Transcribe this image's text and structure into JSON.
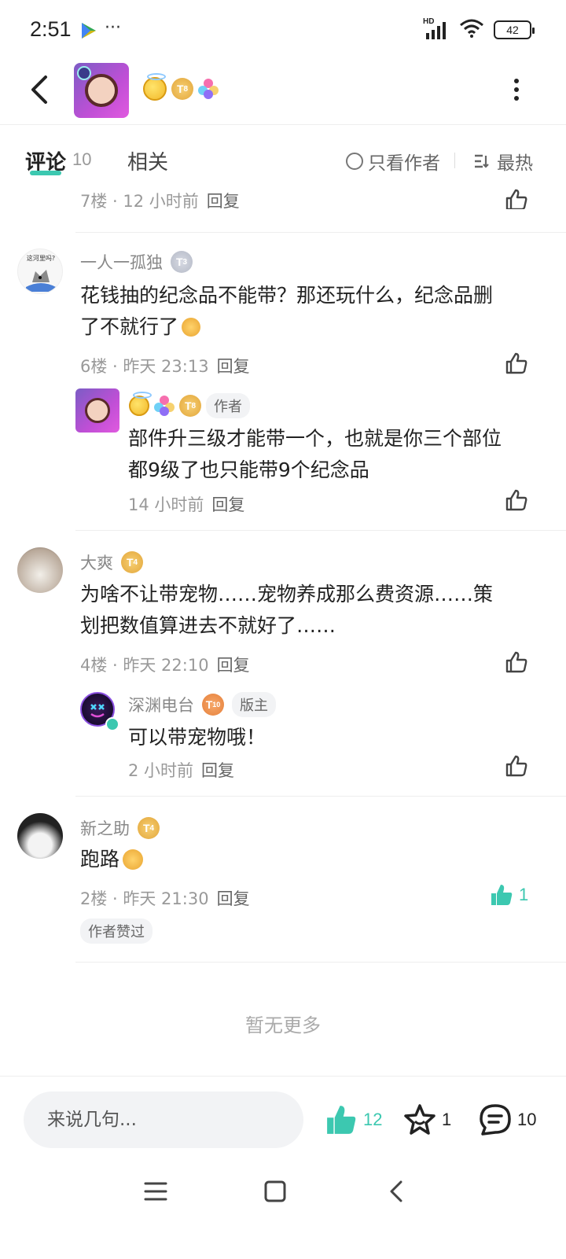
{
  "status_bar": {
    "time": "2:51",
    "dots": "···",
    "network": "HD",
    "battery": "42"
  },
  "header": {
    "level_badge": "8",
    "more_icon": "more-vertical-icon",
    "back_icon": "back-arrow-icon"
  },
  "tabs": {
    "comments_label": "评论",
    "comments_count": "10",
    "related_label": "相关",
    "only_author_label": "只看作者",
    "sort_label": "最热"
  },
  "comments": [
    {
      "floor_meta": "7楼 · 12 小时前",
      "reply": "回复"
    },
    {
      "name": "一人一孤独",
      "level": "3",
      "avatar_caption": "这河里吗?",
      "text_line1": "花钱抽的纪念品不能带？那还玩什么，纪念品删",
      "text_line2": "了不就行了",
      "meta": "6楼 · 昨天 23:13",
      "reply": "回复",
      "sub_reply": {
        "level": "8",
        "author_tag": "作者",
        "text_line1": "部件升三级才能带一个，也就是你三个部位",
        "text_line2": "都9级了也只能带9个纪念品",
        "meta": "14 小时前",
        "reply": "回复"
      }
    },
    {
      "name": "大爽",
      "level": "4",
      "text_line1": "为啥不让带宠物……宠物养成那么费资源……策",
      "text_line2": "划把数值算进去不就好了……",
      "meta": "4楼 · 昨天 22:10",
      "reply": "回复",
      "sub_reply": {
        "name": "深渊电台",
        "level": "10",
        "role_tag": "版主",
        "text": "可以带宠物哦！",
        "meta": "2 小时前",
        "reply": "回复"
      }
    },
    {
      "name": "新之助",
      "level": "4",
      "text": "跑路",
      "meta": "2楼 · 昨天 21:30",
      "reply": "回复",
      "like_count": "1",
      "author_liked_tag": "作者赞过"
    }
  ],
  "footer": {
    "no_more": "暂无更多"
  },
  "bottom_bar": {
    "input_placeholder": "来说几句...",
    "like_count": "12",
    "star_count": "1",
    "comment_count": "10"
  },
  "colors": {
    "accent": "#3cc8b0",
    "text": "#222222",
    "muted": "#999999"
  }
}
